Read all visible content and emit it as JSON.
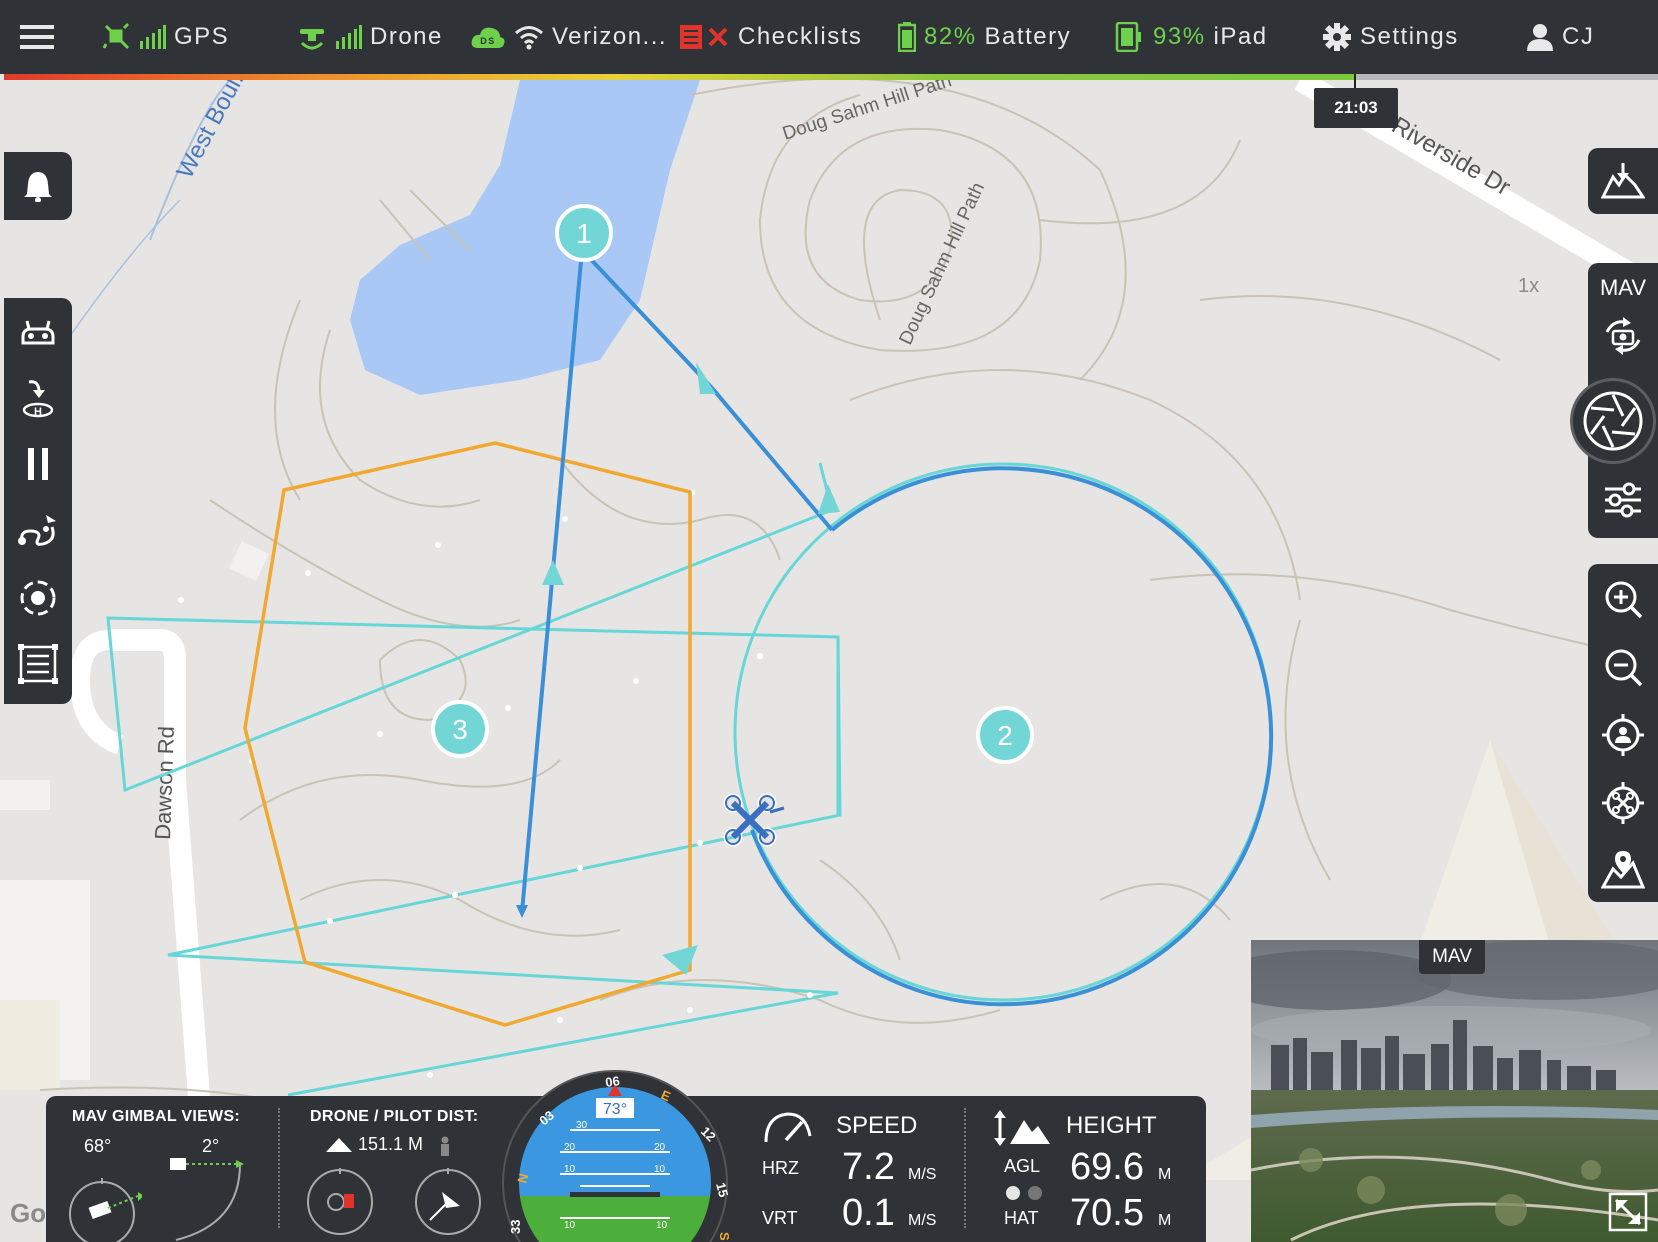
{
  "topbar": {
    "gps_label": "GPS",
    "drone_label": "Drone",
    "carrier_label": "Verizon...",
    "checklists_label": "Checklists",
    "battery_value": "82%",
    "battery_label": "Battery",
    "ipad_value": "93%",
    "ipad_label": "iPad",
    "settings_label": "Settings",
    "user_label": "CJ",
    "ds_badge": "DS",
    "time": "21:03",
    "colors": {
      "bar": "#2f3236",
      "ok": "#6fd04c",
      "error": "#e0332c"
    }
  },
  "map": {
    "streets": [
      "West Boul... Cr",
      "Riverside Dr",
      "Dawson Rd",
      "Doug Sahm Hill Path",
      "Doug Sahm Hill Path"
    ],
    "zoom_label": "1x",
    "attribution": "Google",
    "waypoints": [
      "1",
      "2",
      "3"
    ],
    "colors": {
      "water": "#a9c8f5",
      "path": "#3a8fd6",
      "grid": "#67d6d6",
      "hexagon": "#f0a830",
      "waypoint": "#72d6d6"
    }
  },
  "left_toolbar": {
    "icons": [
      "bell-icon",
      "remote-controller-icon",
      "return-home-icon",
      "pause-icon",
      "flight-path-icon",
      "orbit-icon",
      "survey-grid-icon"
    ]
  },
  "right_toolbar": {
    "mav_label": "MAV",
    "icons": [
      "download-map-icon",
      "switch-camera-icon",
      "shutter-icon",
      "adjust-settings-icon",
      "zoom-in-icon",
      "zoom-out-icon",
      "locate-pilot-icon",
      "locate-drone-icon",
      "map-marker-icon"
    ]
  },
  "telemetry": {
    "gimbal_title": "MAV GIMBAL VIEWS:",
    "gimbal_yaw": "68°",
    "gimbal_pitch": "2°",
    "dist_title": "DRONE / PILOT DIST:",
    "dist_value": "151.1 M",
    "heading": "73°",
    "compass_labels": [
      "03",
      "06",
      "E",
      "12",
      "15",
      "S",
      "33",
      "N"
    ],
    "pitch_ladder": [
      "30",
      "20",
      "10",
      "10",
      "20",
      "10",
      "10"
    ],
    "speed_title": "SPEED",
    "hrz_label": "HRZ",
    "hrz_value": "7.2",
    "hrz_unit": "M/S",
    "vrt_label": "VRT",
    "vrt_value": "0.1",
    "vrt_unit": "M/S",
    "height_title": "HEIGHT",
    "agl_label": "AGL",
    "agl_value": "69.6",
    "agl_unit": "M",
    "hat_label": "HAT",
    "hat_value": "70.5",
    "hat_unit": "M"
  },
  "preview": {
    "label": "MAV"
  }
}
